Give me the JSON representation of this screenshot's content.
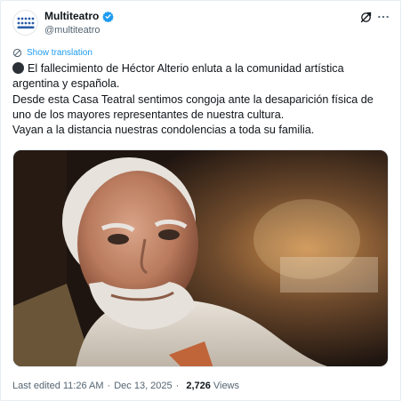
{
  "account": {
    "name": "Multiteatro",
    "handle": "@multiteatro",
    "avatar_icon": "multiteatro-logo",
    "verified_color": "#1d9bf0"
  },
  "actions": {
    "grok_icon": "grok-icon",
    "more_icon": "more-dots-icon"
  },
  "translation": {
    "label": "Show translation",
    "icon": "globe-translate-icon"
  },
  "tweet": {
    "emoji": "black-circle",
    "lines": [
      "El fallecimiento de Héctor Alterio enluta a la comunidad artística",
      "argentina y española.",
      "Desde esta Casa Teatral sentimos congoja ante la desaparición física de",
      "uno de los mayores representantes de nuestra cultura.",
      "Vayan a la distancia nuestras condolencias a toda su familia."
    ]
  },
  "meta": {
    "edited": "Last edited 11:26 AM",
    "separator": "·",
    "date": "Dec 13, 2025",
    "views_count": "2,726",
    "views_label": "Views"
  },
  "colors": {
    "text": "#0f1419",
    "muted": "#536471",
    "link": "#1d9bf0"
  }
}
